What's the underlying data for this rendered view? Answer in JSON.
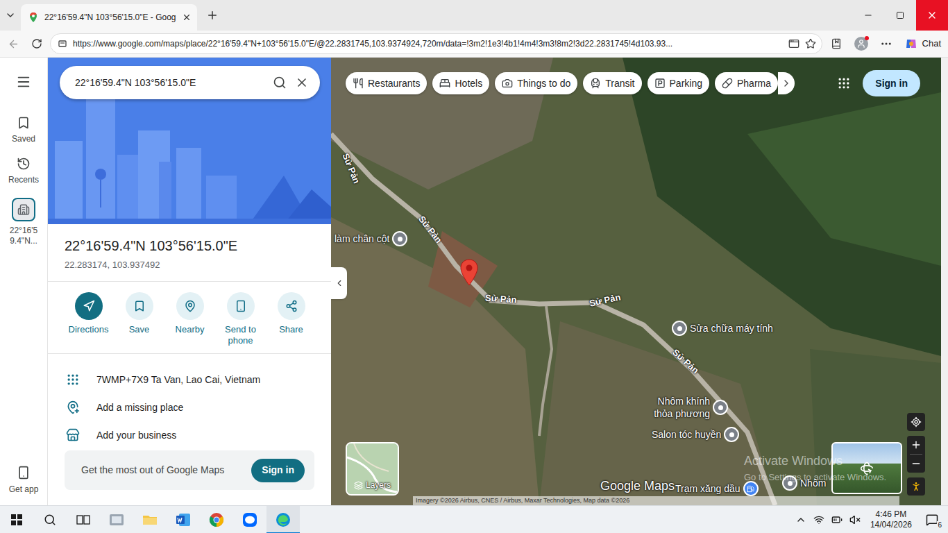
{
  "browser": {
    "tab": {
      "title": "22°16'59.4\"N 103°56'15.0\"E - Goog",
      "selected": true
    },
    "url": "https://www.google.com/maps/place/22°16'59.4\"N+103°56'15.0\"E/@22.2831745,103.9374924,720m/data=!3m2!1e3!4b1!4m4!3m3!8m2!3d22.2831745!4d103.93...",
    "chat": "Chat"
  },
  "rail": {
    "items": [
      {
        "label": "Saved",
        "kind": "saved"
      },
      {
        "label": "Recents",
        "kind": "recents"
      },
      {
        "label": "22°16'59.4\"N...",
        "kind": "recent-place"
      }
    ],
    "get_app": "Get app"
  },
  "panel": {
    "search_value": "22°16'59.4\"N 103°56'15.0\"E",
    "title": "22°16'59.4\"N 103°56'15.0\"E",
    "coords": "22.283174, 103.937492",
    "actions": [
      {
        "label": "Directions",
        "kind": "directions",
        "primary": true
      },
      {
        "label": "Save",
        "kind": "save",
        "primary": false
      },
      {
        "label": "Nearby",
        "kind": "nearby",
        "primary": false
      },
      {
        "label": "Send to phone",
        "kind": "send",
        "primary": false
      },
      {
        "label": "Share",
        "kind": "share",
        "primary": false
      }
    ],
    "info": [
      {
        "text": "7WMP+7X9 Ta Van, Lao Cai, Vietnam",
        "kind": "plus-code"
      },
      {
        "text": "Add a missing place",
        "kind": "add-place"
      },
      {
        "text": "Add your business",
        "kind": "add-business"
      }
    ],
    "promo": {
      "text": "Get the most out of Google Maps",
      "button": "Sign in"
    }
  },
  "map": {
    "chips": [
      {
        "label": "Restaurants",
        "kind": "restaurants"
      },
      {
        "label": "Hotels",
        "kind": "hotels"
      },
      {
        "label": "Things to do",
        "kind": "things"
      },
      {
        "label": "Transit",
        "kind": "transit"
      },
      {
        "label": "Parking",
        "kind": "parking"
      },
      {
        "label": "Pharma",
        "kind": "pharmacy"
      }
    ],
    "sign_in": "Sign in",
    "roads": [
      {
        "text": "Sử Pản"
      },
      {
        "text": "Sử Pản"
      },
      {
        "text": "Sử Pản"
      },
      {
        "text": "Sử Pản"
      },
      {
        "text": "Sử Pản"
      }
    ],
    "places": [
      {
        "text": "làm chân cột",
        "kind": "place"
      },
      {
        "text": "Sửa chữa máy tính",
        "kind": "place"
      },
      {
        "text": "Nhôm khính thỏa phương",
        "kind": "place"
      },
      {
        "text": "Salon tóc huyền",
        "kind": "place"
      },
      {
        "text": "Trạm xăng dầu",
        "kind": "gas"
      },
      {
        "text": "Nhôm",
        "kind": "place"
      }
    ],
    "layers": "Layers",
    "logo": "Google Maps",
    "attribution": "Imagery ©2026 Airbus, CNES / Airbus, Maxar Technologies, Map data ©2026",
    "activation": {
      "title": "Activate Windows",
      "subtitle": "Go to Settings to activate Windows."
    }
  },
  "taskbar": {
    "apps": [
      {
        "kind": "photos",
        "selected": false
      },
      {
        "kind": "explorer",
        "selected": false
      },
      {
        "kind": "word",
        "selected": false
      },
      {
        "kind": "chrome",
        "selected": false
      },
      {
        "kind": "zalo",
        "selected": false
      },
      {
        "kind": "edge",
        "selected": true
      }
    ],
    "time": "4:46 PM",
    "date": "14/04/2026",
    "notifications": "6"
  }
}
